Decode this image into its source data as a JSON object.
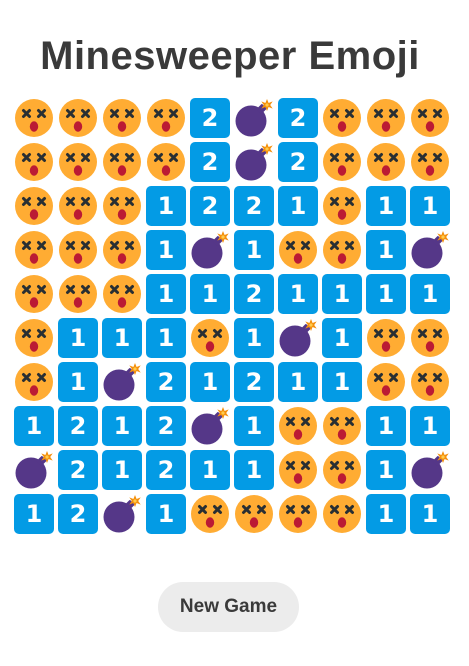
{
  "title": "Minesweeper Emoji",
  "new_game_label": "New Game",
  "colors": {
    "number_tile": "#039be5",
    "face": "#ffac33",
    "bomb": "#553788",
    "spark": "#f4900c",
    "mouth": "#bb1a34"
  },
  "legend": {
    "X": "dizzy-face-icon",
    "B": "bomb-icon",
    "digit": "number-tile"
  },
  "board": [
    [
      "X",
      "X",
      "X",
      "X",
      "2",
      "B",
      "2",
      "X",
      "X",
      "X"
    ],
    [
      "X",
      "X",
      "X",
      "X",
      "2",
      "B",
      "2",
      "X",
      "X",
      "X"
    ],
    [
      "X",
      "X",
      "X",
      "1",
      "2",
      "2",
      "1",
      "X",
      "1",
      "1"
    ],
    [
      "X",
      "X",
      "X",
      "1",
      "B",
      "1",
      "X",
      "X",
      "1",
      "B"
    ],
    [
      "X",
      "X",
      "X",
      "1",
      "1",
      "2",
      "1",
      "1",
      "1",
      "1"
    ],
    [
      "X",
      "1",
      "1",
      "1",
      "X",
      "1",
      "B",
      "1",
      "X",
      "X"
    ],
    [
      "X",
      "1",
      "B",
      "2",
      "1",
      "2",
      "1",
      "1",
      "X",
      "X"
    ],
    [
      "1",
      "2",
      "1",
      "2",
      "B",
      "1",
      "X",
      "X",
      "1",
      "1"
    ],
    [
      "B",
      "2",
      "1",
      "2",
      "1",
      "1",
      "X",
      "X",
      "1",
      "B"
    ],
    [
      "1",
      "2",
      "B",
      "1",
      "X",
      "X",
      "X",
      "X",
      "1",
      "1"
    ]
  ]
}
